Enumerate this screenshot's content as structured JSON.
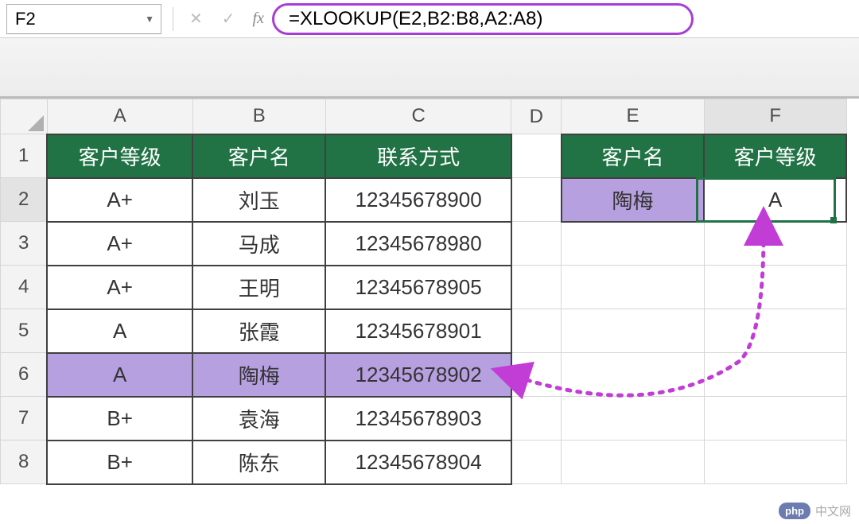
{
  "name_box": "F2",
  "formula": "=XLOOKUP(E2,B2:B8,A2:A8)",
  "columns": [
    "A",
    "B",
    "C",
    "D",
    "E",
    "F"
  ],
  "row_numbers": [
    "1",
    "2",
    "3",
    "4",
    "5",
    "6",
    "7",
    "8"
  ],
  "headers_left": {
    "A": "客户等级",
    "B": "客户名",
    "C": "联系方式"
  },
  "headers_right": {
    "E": "客户名",
    "F": "客户等级"
  },
  "data": [
    {
      "A": "A+",
      "B": "刘玉",
      "C": "12345678900"
    },
    {
      "A": "A+",
      "B": "马成",
      "C": "12345678980"
    },
    {
      "A": "A+",
      "B": "王明",
      "C": "12345678905"
    },
    {
      "A": "A",
      "B": "张霞",
      "C": "12345678901"
    },
    {
      "A": "A",
      "B": "陶梅",
      "C": "12345678902"
    },
    {
      "A": "B+",
      "B": "袁海",
      "C": "12345678903"
    },
    {
      "A": "B+",
      "B": "陈东",
      "C": "12345678904"
    }
  ],
  "lookup_value": "陶梅",
  "lookup_result": "A",
  "watermark": {
    "badge": "php",
    "text": "中文网"
  },
  "chart_data": {
    "type": "table",
    "title": "XLOOKUP reverse lookup example",
    "left_table": {
      "columns": [
        "客户等级",
        "客户名",
        "联系方式"
      ],
      "rows": [
        [
          "A+",
          "刘玉",
          "12345678900"
        ],
        [
          "A+",
          "马成",
          "12345678980"
        ],
        [
          "A+",
          "王明",
          "12345678905"
        ],
        [
          "A",
          "张霞",
          "12345678901"
        ],
        [
          "A",
          "陶梅",
          "12345678902"
        ],
        [
          "B+",
          "袁海",
          "12345678903"
        ],
        [
          "B+",
          "陈东",
          "12345678904"
        ]
      ]
    },
    "right_table": {
      "columns": [
        "客户名",
        "客户等级"
      ],
      "rows": [
        [
          "陶梅",
          "A"
        ]
      ]
    },
    "formula_in_F2": "=XLOOKUP(E2,B2:B8,A2:A8)"
  }
}
